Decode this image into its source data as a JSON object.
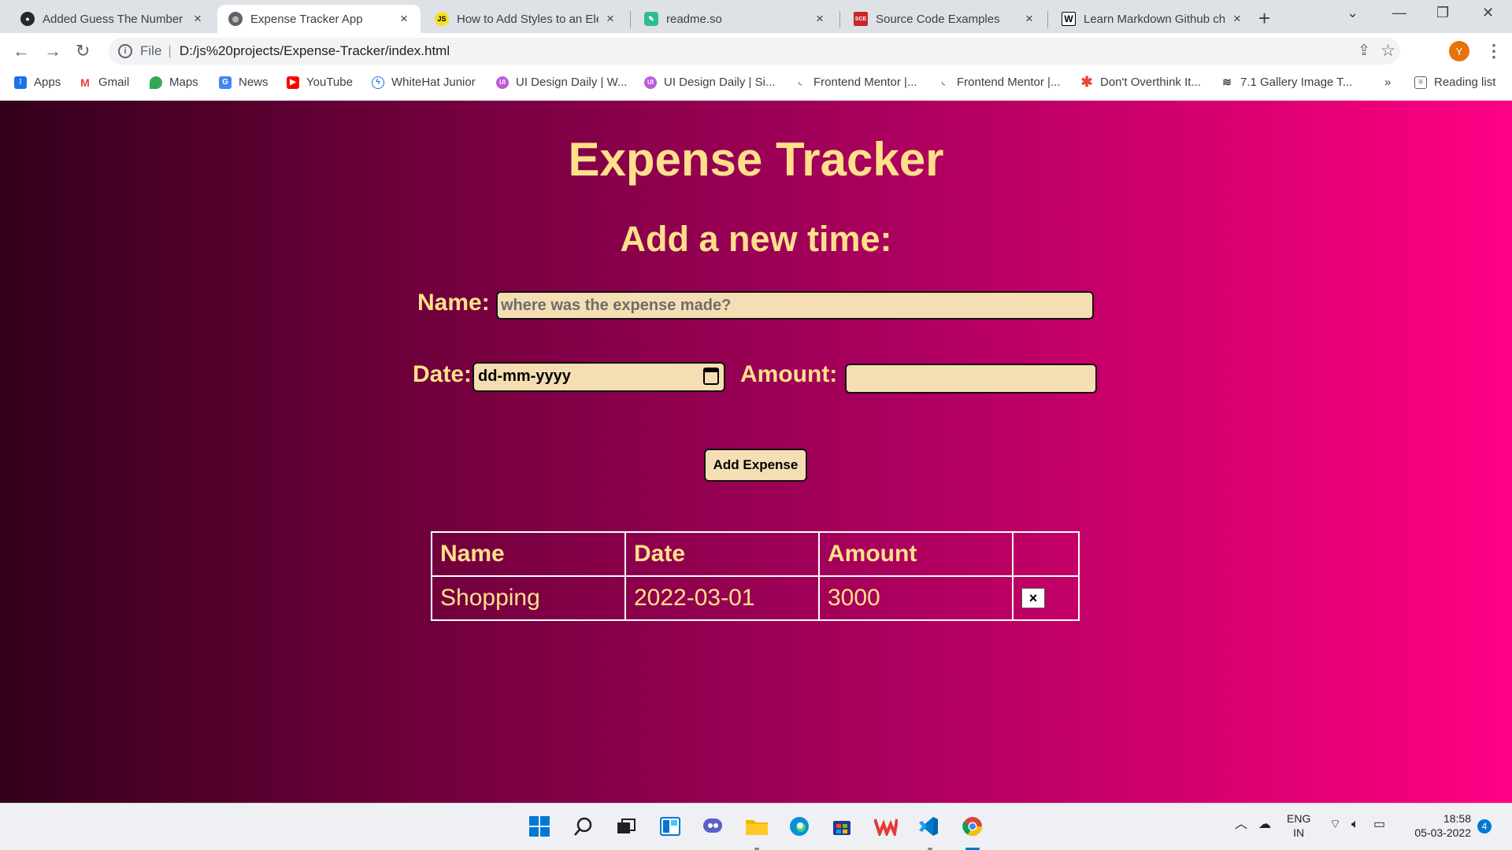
{
  "browser": {
    "tabs": [
      {
        "title": "Added Guess The Number",
        "favicon": "github-icon"
      },
      {
        "title": "Expense Tracker App",
        "favicon": "globe-icon",
        "active": true
      },
      {
        "title": "How to Add Styles to an Ele",
        "favicon": "js-icon"
      },
      {
        "title": "readme.so",
        "favicon": "readme-icon"
      },
      {
        "title": "Source Code Examples",
        "favicon": "sce-icon"
      },
      {
        "title": "Learn Markdown Github ch",
        "favicon": "w-icon"
      }
    ],
    "address": {
      "scheme": "File",
      "url": "D:/js%20projects/Expense-Tracker/index.html"
    },
    "profile_initial": "Y",
    "bookmarks": [
      "Apps",
      "Gmail",
      "Maps",
      "News",
      "YouTube",
      "WhiteHat Junior",
      "UI Design Daily | W...",
      "UI Design Daily | Si...",
      "Frontend Mentor |...",
      "Frontend Mentor |...",
      "Don't Overthink It...",
      "7.1 Gallery Image T..."
    ],
    "overflow": "»",
    "reading_list": "Reading list"
  },
  "page": {
    "title": "Expense Tracker",
    "subtitle": "Add a new time:",
    "name_label": "Name:",
    "name_placeholder": "where was the expense made?",
    "date_label": "Date:",
    "date_placeholder": "dd-mm-yyyy",
    "amount_label": "Amount:",
    "add_button": "Add Expense",
    "table": {
      "headers": [
        "Name",
        "Date",
        "Amount",
        ""
      ],
      "rows": [
        {
          "name": "Shopping",
          "date": "2022-03-01",
          "amount": "3000",
          "delete": "×"
        }
      ]
    }
  },
  "taskbar": {
    "lang": "ENG",
    "region": "IN",
    "time": "18:58",
    "date": "05-03-2022",
    "notifications": "4"
  }
}
